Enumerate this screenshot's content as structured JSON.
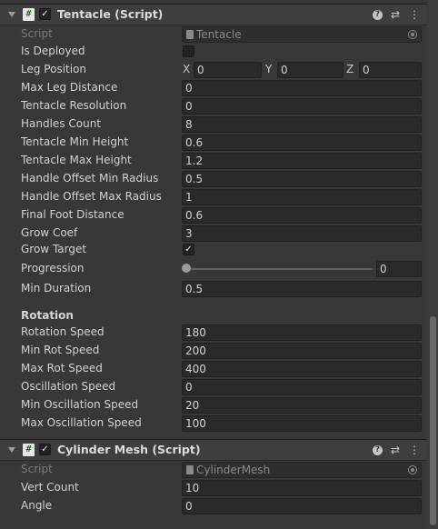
{
  "tentacle": {
    "title": "Tentacle (Script)",
    "enabled_mark": "✓",
    "script_label": "Script",
    "script_value": "Tentacle",
    "fields": [
      {
        "label": "Is Deployed",
        "kind": "checkbox",
        "checked": ""
      },
      {
        "label": "Leg Position",
        "kind": "vector3",
        "x": "0",
        "y": "0",
        "z": "0"
      },
      {
        "label": "Max Leg Distance",
        "value": "0"
      },
      {
        "label": "Tentacle Resolution",
        "value": "0"
      },
      {
        "label": "Handles Count",
        "value": "8"
      },
      {
        "label": "Tentacle Min Height",
        "value": "0.6"
      },
      {
        "label": "Tentacle Max Height",
        "value": "1.2"
      },
      {
        "label": "Handle Offset Min Radius",
        "value": "0.5"
      },
      {
        "label": "Handle Offset Max Radius",
        "value": "1"
      },
      {
        "label": "Final Foot Distance",
        "value": "0.6"
      },
      {
        "label": "Grow Coef",
        "value": "3"
      },
      {
        "label": "Grow Target",
        "kind": "checkbox",
        "checked": "✓"
      },
      {
        "label": "Progression",
        "kind": "slider",
        "value": "0",
        "fraction": 0
      },
      {
        "label": "Min Duration",
        "value": "0.5"
      }
    ],
    "rotation_header": "Rotation",
    "rotation_fields": [
      {
        "label": "Rotation Speed",
        "value": "180"
      },
      {
        "label": "Min Rot Speed",
        "value": "200"
      },
      {
        "label": "Max Rot Speed",
        "value": "400"
      },
      {
        "label": "Oscillation Speed",
        "value": "0"
      },
      {
        "label": "Min Oscillation Speed",
        "value": "20"
      },
      {
        "label": "Max Oscillation Speed",
        "value": "100"
      }
    ],
    "axis_labels": {
      "x": "X",
      "y": "Y",
      "z": "Z"
    }
  },
  "cylinder": {
    "title": "Cylinder Mesh (Script)",
    "enabled_mark": "✓",
    "script_label": "Script",
    "script_value": "CylinderMesh",
    "fields": [
      {
        "label": "Vert Count",
        "value": "10"
      },
      {
        "label": "Angle",
        "value": "0"
      }
    ]
  },
  "header_icons": {
    "script": "#",
    "help": "?",
    "presets": "⇄",
    "menu": "⋮"
  },
  "colors": {
    "background": "#383838",
    "field": "#2a2a2a",
    "text": "#d2d2d2"
  }
}
